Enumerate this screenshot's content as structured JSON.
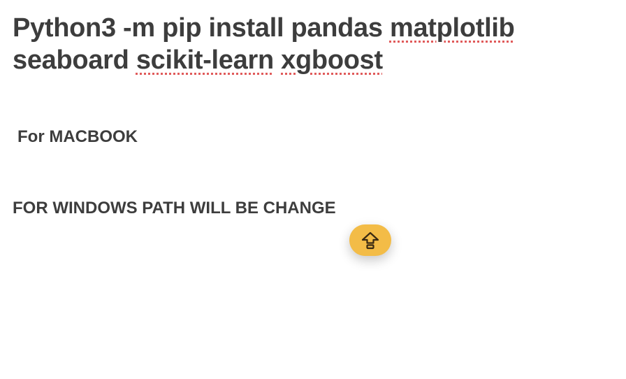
{
  "heading": {
    "line1": {
      "plain": "Python3 -m pip install pandas ",
      "misspelled": "matplotlib"
    },
    "line2": {
      "word1": "seaboard",
      "sep1": " ",
      "word2_misspelled": "scikit-learn",
      "sep2": " ",
      "word3_misspelled": "xgboost"
    }
  },
  "subheadings": {
    "mac": "For MACBOOK",
    "windows": "FOR WINDOWS PATH WILL BE CHANGE"
  },
  "fab": {
    "icon": "shift-arrow-up-icon",
    "color": "#f3bc47"
  }
}
